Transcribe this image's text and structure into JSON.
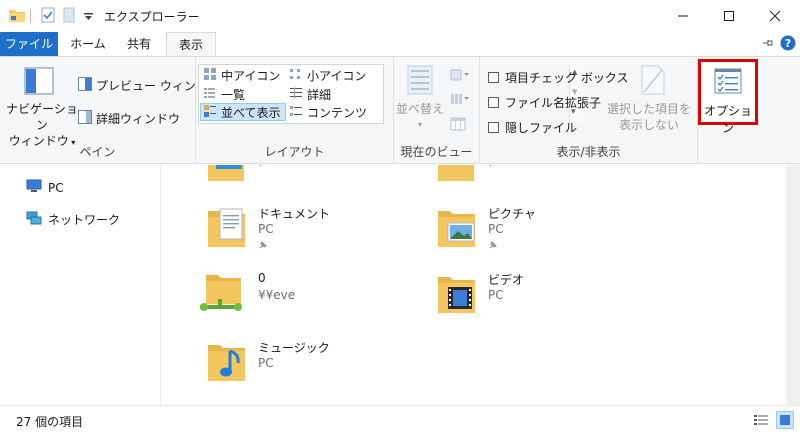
{
  "window": {
    "title": "エクスプローラー"
  },
  "tabs": [
    {
      "label": "ファイル"
    },
    {
      "label": "ホーム"
    },
    {
      "label": "共有"
    },
    {
      "label": "表示"
    }
  ],
  "ribbon": {
    "pane_group": {
      "label": "ペイン",
      "nav_pane_line1": "ナビゲーション",
      "nav_pane_line2": "ウィンドウ",
      "preview_pane": "プレビュー ウィンドウ",
      "details_pane": "詳細ウィンドウ"
    },
    "layout_group": {
      "label": "レイアウト",
      "items": [
        {
          "label": "中アイコン"
        },
        {
          "label": "小アイコン"
        },
        {
          "label": "一覧"
        },
        {
          "label": "詳細"
        },
        {
          "label": "並べて表示"
        },
        {
          "label": "コンテンツ"
        }
      ]
    },
    "current_view_group": {
      "label": "現在のビュー",
      "sort_line1": "並べ替え"
    },
    "show_hide_group": {
      "label": "表示/非表示",
      "item_checkboxes": "項目チェック ボックス",
      "file_extensions": "ファイル名拡張子",
      "hidden_files": "隠しファイル",
      "hide_selected_line1": "選択した項目を",
      "hide_selected_line2": "表示しない"
    },
    "options": {
      "label": "オプション"
    }
  },
  "nav": {
    "items": [
      {
        "label": "PC"
      },
      {
        "label": "ネットワーク"
      }
    ]
  },
  "content": {
    "partial_sub": "PC",
    "tiles": [
      {
        "name": "ドキュメント",
        "sub": "PC"
      },
      {
        "name": "ピクチャ",
        "sub": "PC"
      },
      {
        "name": "0",
        "sub": "¥¥eve"
      },
      {
        "name": "ビデオ",
        "sub": "PC"
      },
      {
        "name": "ミュージック",
        "sub": "PC"
      }
    ]
  },
  "status": {
    "item_count": "27 個の項目"
  },
  "colors": {
    "file_tab": "#1e6fc8",
    "highlight": "#e10000",
    "folder": "#f3c65f",
    "selected": "#cce4f7"
  }
}
